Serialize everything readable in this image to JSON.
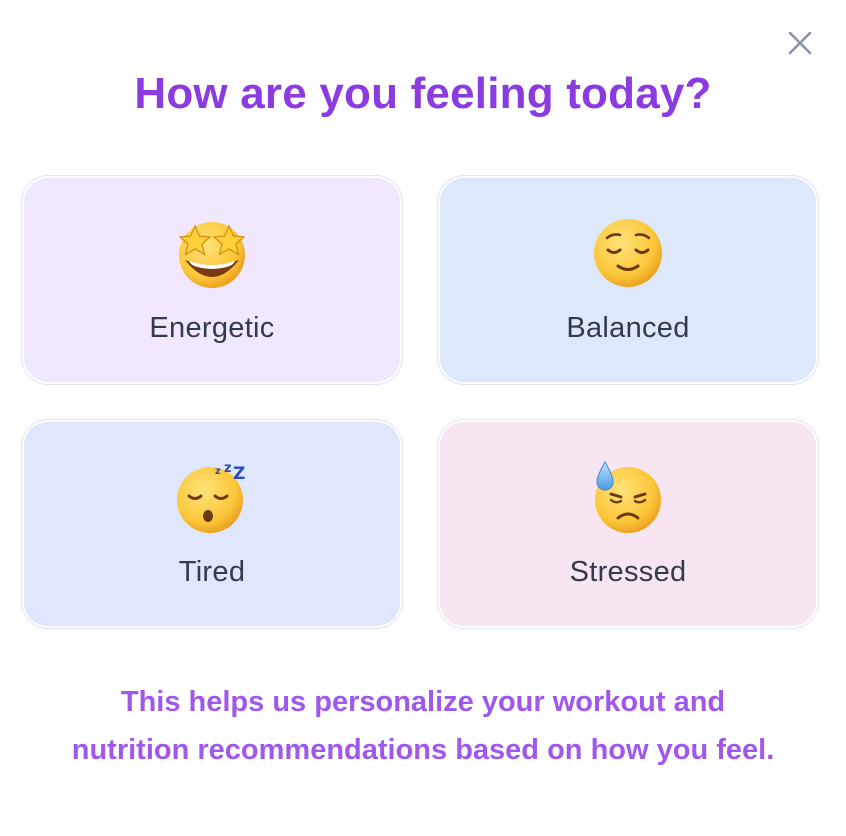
{
  "title": "How are you feeling today?",
  "close_icon": "close-icon",
  "moods": [
    {
      "label": "Energetic",
      "icon": "star-struck-face-icon",
      "color": "#f1e8fd"
    },
    {
      "label": "Balanced",
      "icon": "relieved-face-icon",
      "color": "#dde8fb"
    },
    {
      "label": "Tired",
      "icon": "sleeping-face-icon",
      "color": "#e0e6fb"
    },
    {
      "label": "Stressed",
      "icon": "downcast-face-with-sweat-icon",
      "color": "#f7e6f1"
    }
  ],
  "footer_text": "This helps us personalize your workout and nutrition recommendations based on how you feel.",
  "colors": {
    "accent": "#8b3be0",
    "footer": "#a057ec",
    "label": "#333a4d"
  }
}
